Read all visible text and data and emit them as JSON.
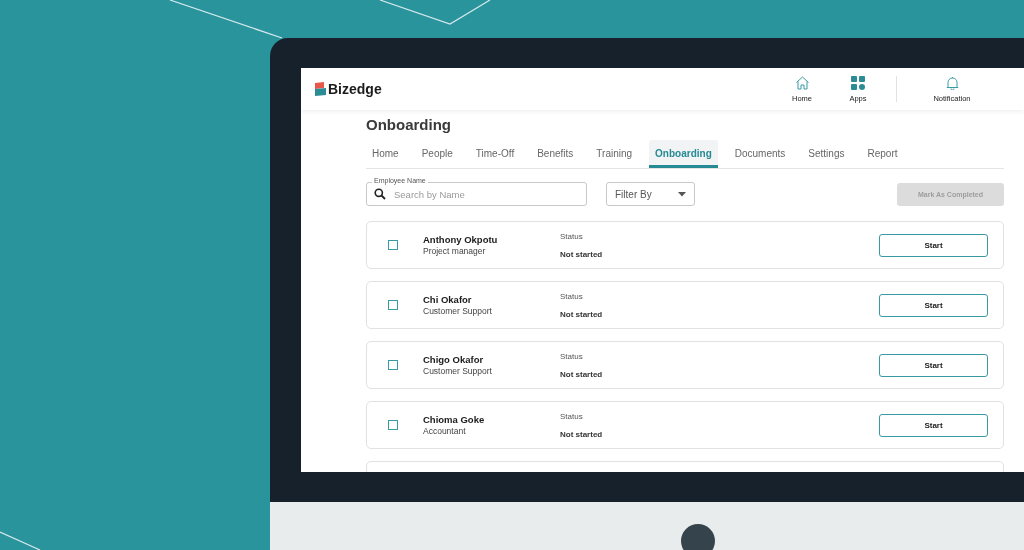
{
  "header": {
    "logo": "Bizedge",
    "nav": [
      {
        "label": "Home",
        "kind": "home"
      },
      {
        "label": "Apps",
        "kind": "apps"
      },
      {
        "label": "Notification",
        "kind": "bell"
      }
    ]
  },
  "page": {
    "title": "Onboarding",
    "tabs": [
      {
        "label": "Home",
        "selected": false
      },
      {
        "label": "People",
        "selected": false
      },
      {
        "label": "Time-Off",
        "selected": false
      },
      {
        "label": "Benefits",
        "selected": false
      },
      {
        "label": "Training",
        "selected": false
      },
      {
        "label": "Onboarding",
        "selected": true
      },
      {
        "label": "Documents",
        "selected": false
      },
      {
        "label": "Settings",
        "selected": false
      },
      {
        "label": "Report",
        "selected": false
      }
    ],
    "search": {
      "label": "Employee Name",
      "placeholder": "Search by Name"
    },
    "filter": {
      "label": "Filter By"
    },
    "mark_button": {
      "label": "Mark As Completed",
      "disabled": true
    }
  },
  "employees": [
    {
      "name": "Anthony Okpotu",
      "role": "Project manager",
      "status_label": "Status",
      "status": "Not started",
      "checked": false,
      "action": "Start"
    },
    {
      "name": "Chi Okafor",
      "role": "Customer Support",
      "status_label": "Status",
      "status": "Not started",
      "checked": false,
      "action": "Start"
    },
    {
      "name": "Chigo Okafor",
      "role": "Customer Support",
      "status_label": "Status",
      "status": "Not started",
      "checked": false,
      "action": "Start"
    },
    {
      "name": "Chioma Goke",
      "role": "Accountant",
      "status_label": "Status",
      "status": "Not started",
      "checked": false,
      "action": "Start"
    }
  ],
  "more_rows_below": true
}
